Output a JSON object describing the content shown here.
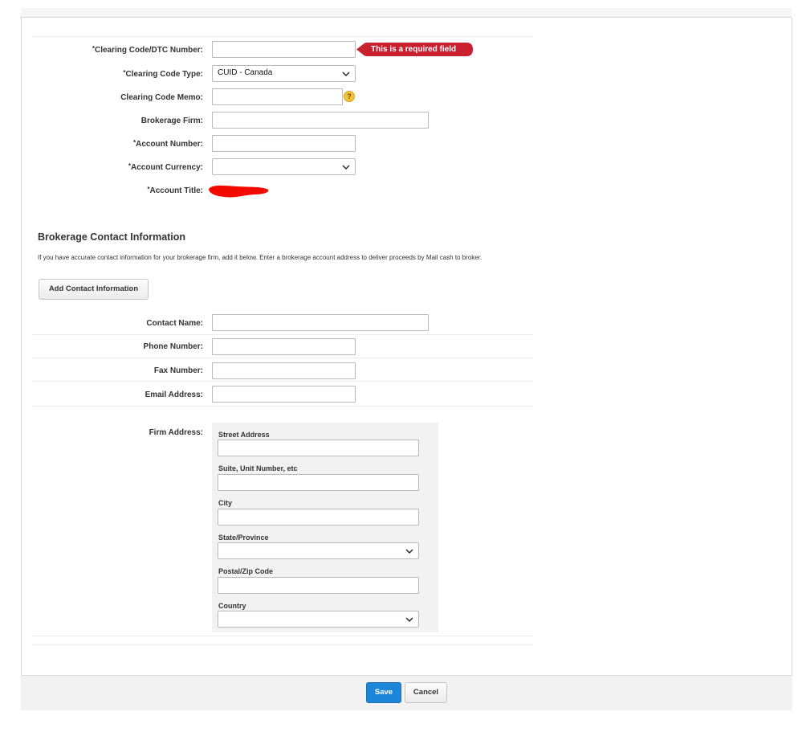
{
  "form": {
    "clearing_code_label": "Clearing Code/DTC Number:",
    "required_error": "This is a required field",
    "clearing_code_type_label": "Clearing Code Type:",
    "clearing_code_type_value": "CUID - Canada",
    "clearing_code_memo_label": "Clearing Code Memo:",
    "help_glyph": "?",
    "brokerage_firm_label": "Brokerage Firm:",
    "account_number_label": "Account Number:",
    "account_currency_label": "Account Currency:",
    "account_currency_value": "",
    "account_title_label": "Account Title:",
    "required_marker": "*"
  },
  "contact": {
    "title": "Brokerage Contact Information",
    "description": "If you have accurate contact information for your brokerage firm, add it below. Enter a brokerage account address to deliver proceeds by Mail cash to broker.",
    "add_button": "Add Contact Information",
    "contact_name_label": "Contact Name:",
    "phone_label": "Phone Number:",
    "fax_label": "Fax Number:",
    "email_label": "Email Address:",
    "firm_address_label": "Firm Address:"
  },
  "address": {
    "street_label": "Street Address",
    "suite_label": "Suite, Unit Number, etc",
    "city_label": "City",
    "state_label": "State/Province",
    "state_value": "",
    "postal_label": "Postal/Zip Code",
    "country_label": "Country",
    "country_value": ""
  },
  "footer": {
    "save": "Save",
    "cancel": "Cancel"
  },
  "colors": {
    "error_red": "#c8202f",
    "primary_blue": "#1c87d9",
    "help_yellow": "#f3c43a",
    "redaction_red": "#f20a00"
  }
}
